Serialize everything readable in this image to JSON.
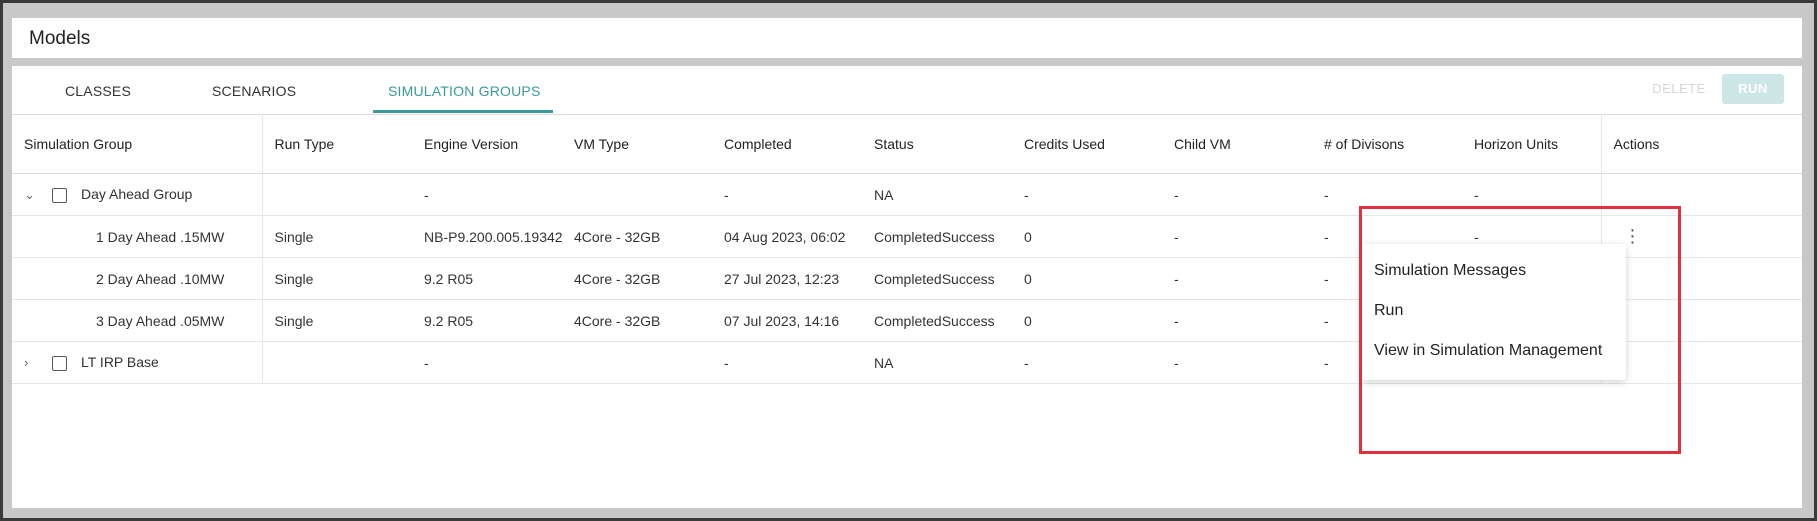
{
  "page": {
    "title": "Models"
  },
  "tabs": [
    {
      "label": "CLASSES"
    },
    {
      "label": "SCENARIOS"
    },
    {
      "label": "SIMULATION GROUPS"
    }
  ],
  "actions": {
    "delete_label": "DELETE",
    "run_label": "RUN"
  },
  "table": {
    "headers": [
      "Simulation Group",
      "Run Type",
      "Engine Version",
      "VM Type",
      "Completed",
      "Status",
      "Credits Used",
      "Child VM",
      "# of Divisons",
      "Horizon Units",
      "Actions"
    ],
    "rows": [
      {
        "kind": "group",
        "expanded": true,
        "name": "Day Ahead Group",
        "run_type": "",
        "engine": "-",
        "vm": "",
        "completed": "-",
        "status": "NA",
        "credits": "-",
        "child_vm": "-",
        "divisions": "-",
        "horizon": "-"
      },
      {
        "kind": "child",
        "name": "1 Day Ahead .15MW",
        "run_type": "Single",
        "engine": "NB-P9.200.005.19342",
        "vm": "4Core - 32GB",
        "completed": "04 Aug 2023, 06:02",
        "status": "CompletedSuccess",
        "credits": "0",
        "child_vm": "-",
        "divisions": "-",
        "horizon": "-"
      },
      {
        "kind": "child",
        "name": "2 Day Ahead .10MW",
        "run_type": "Single",
        "engine": "9.2 R05",
        "vm": "4Core - 32GB",
        "completed": "27 Jul 2023, 12:23",
        "status": "CompletedSuccess",
        "credits": "0",
        "child_vm": "-",
        "divisions": "-",
        "horizon": ""
      },
      {
        "kind": "child",
        "name": "3 Day Ahead .05MW",
        "run_type": "Single",
        "engine": "9.2 R05",
        "vm": "4Core - 32GB",
        "completed": "07 Jul 2023, 14:16",
        "status": "CompletedSuccess",
        "credits": "0",
        "child_vm": "-",
        "divisions": "-",
        "horizon": ""
      },
      {
        "kind": "group",
        "expanded": false,
        "name": "LT IRP Base",
        "run_type": "",
        "engine": "-",
        "vm": "",
        "completed": "-",
        "status": "NA",
        "credits": "-",
        "child_vm": "-",
        "divisions": "-",
        "horizon": ""
      }
    ]
  },
  "context_menu": {
    "items": [
      "Simulation Messages",
      "Run",
      "View in Simulation Management"
    ]
  },
  "icons": {
    "expanded": "chevron-down-icon",
    "collapsed": "chevron-right-icon",
    "kebab": "kebab-menu-icon"
  },
  "colors": {
    "accent": "#3a9a9c",
    "highlight": "#e0313c",
    "run_button_bg": "#cde6e6"
  }
}
